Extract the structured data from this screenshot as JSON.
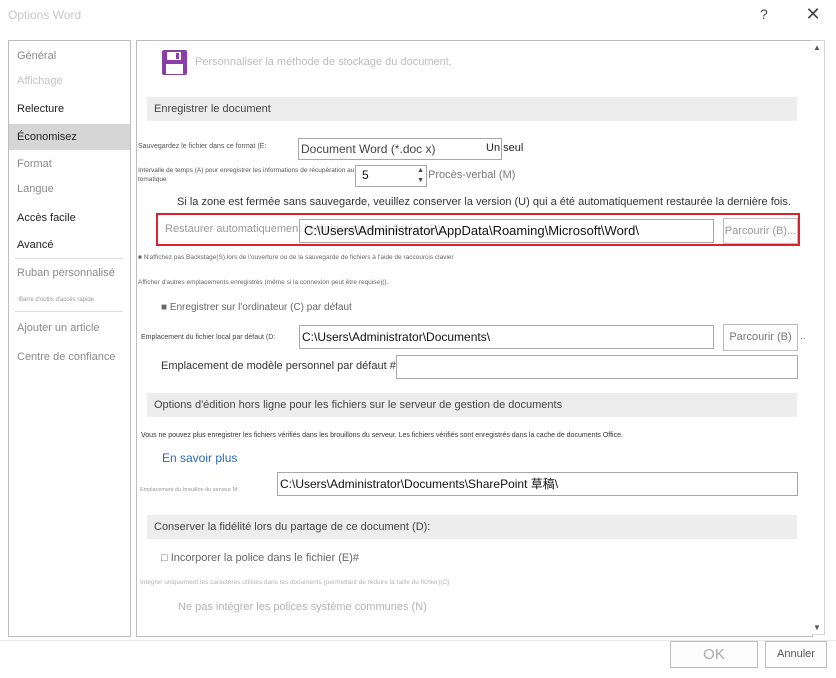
{
  "window": {
    "title": "Options Word",
    "help_glyph": "?",
    "close_glyph": "✕"
  },
  "sidebar": {
    "items": [
      {
        "label": "Général"
      },
      {
        "label": "Affichage"
      },
      {
        "label": "Relecture"
      },
      {
        "label": "Économisez"
      },
      {
        "label": "Format"
      },
      {
        "label": "Langue"
      },
      {
        "label": "Accès facile"
      },
      {
        "label": "Avancé"
      },
      {
        "label": "Ruban personnalisé"
      },
      {
        "label": "Barre d'outils d'accès rapide"
      },
      {
        "label": "Ajouter un article"
      },
      {
        "label": "Centre de confiance"
      }
    ],
    "active_index": 3
  },
  "main": {
    "header_title": "Personnaliser la méthode de stockage du document.",
    "section_save": "Enregistrer le document",
    "save_format_label": "Sauvegardez le fichier dans ce format (E:",
    "save_format_value": "Document Word (*.doc x)",
    "save_format_suffix": "Un seul",
    "autorecover_label": "Intervalle de temps (A) pour enregistrer les informations de récupération au-tomatique",
    "autorecover_value": "5",
    "autorecover_unit": "Procès-verbal (M)",
    "keep_version_text": "Si la zone est fermée sans sauvegarde, veuillez conserver la version (U) qui a été automatiquement restaurée la dernière fois.",
    "autorecover_location_label": "Restaurer automatiquement l'emplacement du fichier (R):",
    "autorecover_location_value": "C:\\Users\\Administrator\\AppData\\Roaming\\Microsoft\\Word\\",
    "browse_label": "Parcourir (B)...",
    "backstage_text": "■ N'affichez pas Backstage(S) lors de l'ouverture ou de la sauvegarde de fichiers à l'aide de raccourcis clavier",
    "other_locations_text": "Afficher d'autres emplacements enregistrés (même si la connexion peut être requise)().",
    "save_to_computer_text": "■ Enregistrer sur l'ordinateur (C) par défaut",
    "local_location_label": "Emplacement du fichier local par défaut (D:",
    "local_location_value": "C:\\Users\\Administrator\\Documents\\",
    "browse2_label": "Parcourir (B)",
    "browse2_suffix": "..",
    "template_location_label": "Emplacement de modèle personnel par défaut #:",
    "template_location_value": "",
    "section_offline": "Options d'édition hors ligne pour les fichiers sur le serveur de gestion de documents",
    "offline_info": "Vous ne pouvez plus enregistrer les fichiers vérifiés dans les brouillons du serveur. Les fichiers vérifiés sont enregistrés dans la cache de documents Office.",
    "learn_more": "En savoir plus",
    "server_drafts_label": "Emplacement du brouillon du serveur M:",
    "server_drafts_value": "C:\\Users\\Administrator\\Documents\\SharePoint 草稿\\",
    "section_fidelity": "Conserver la fidélité lors du partage de ce document (D):",
    "embed_fonts_text": "□ Incorporer la police dans le fichier (E)#",
    "embed_used_chars_text": "Intégrer uniquement les caractères utilisés dans les documents (permettant de réduire la taille du fichier)(C)",
    "no_system_fonts_text": "Ne pas intégrer les polices système communes (N)"
  },
  "footer": {
    "ok_label": "OK",
    "cancel_label": "Annuler"
  },
  "colors": {
    "highlight": "#d9232d",
    "save_icon": "#8a3ea8",
    "link": "#2b6cb0"
  },
  "icons": {
    "save_icon": "floppy-disk-icon"
  }
}
